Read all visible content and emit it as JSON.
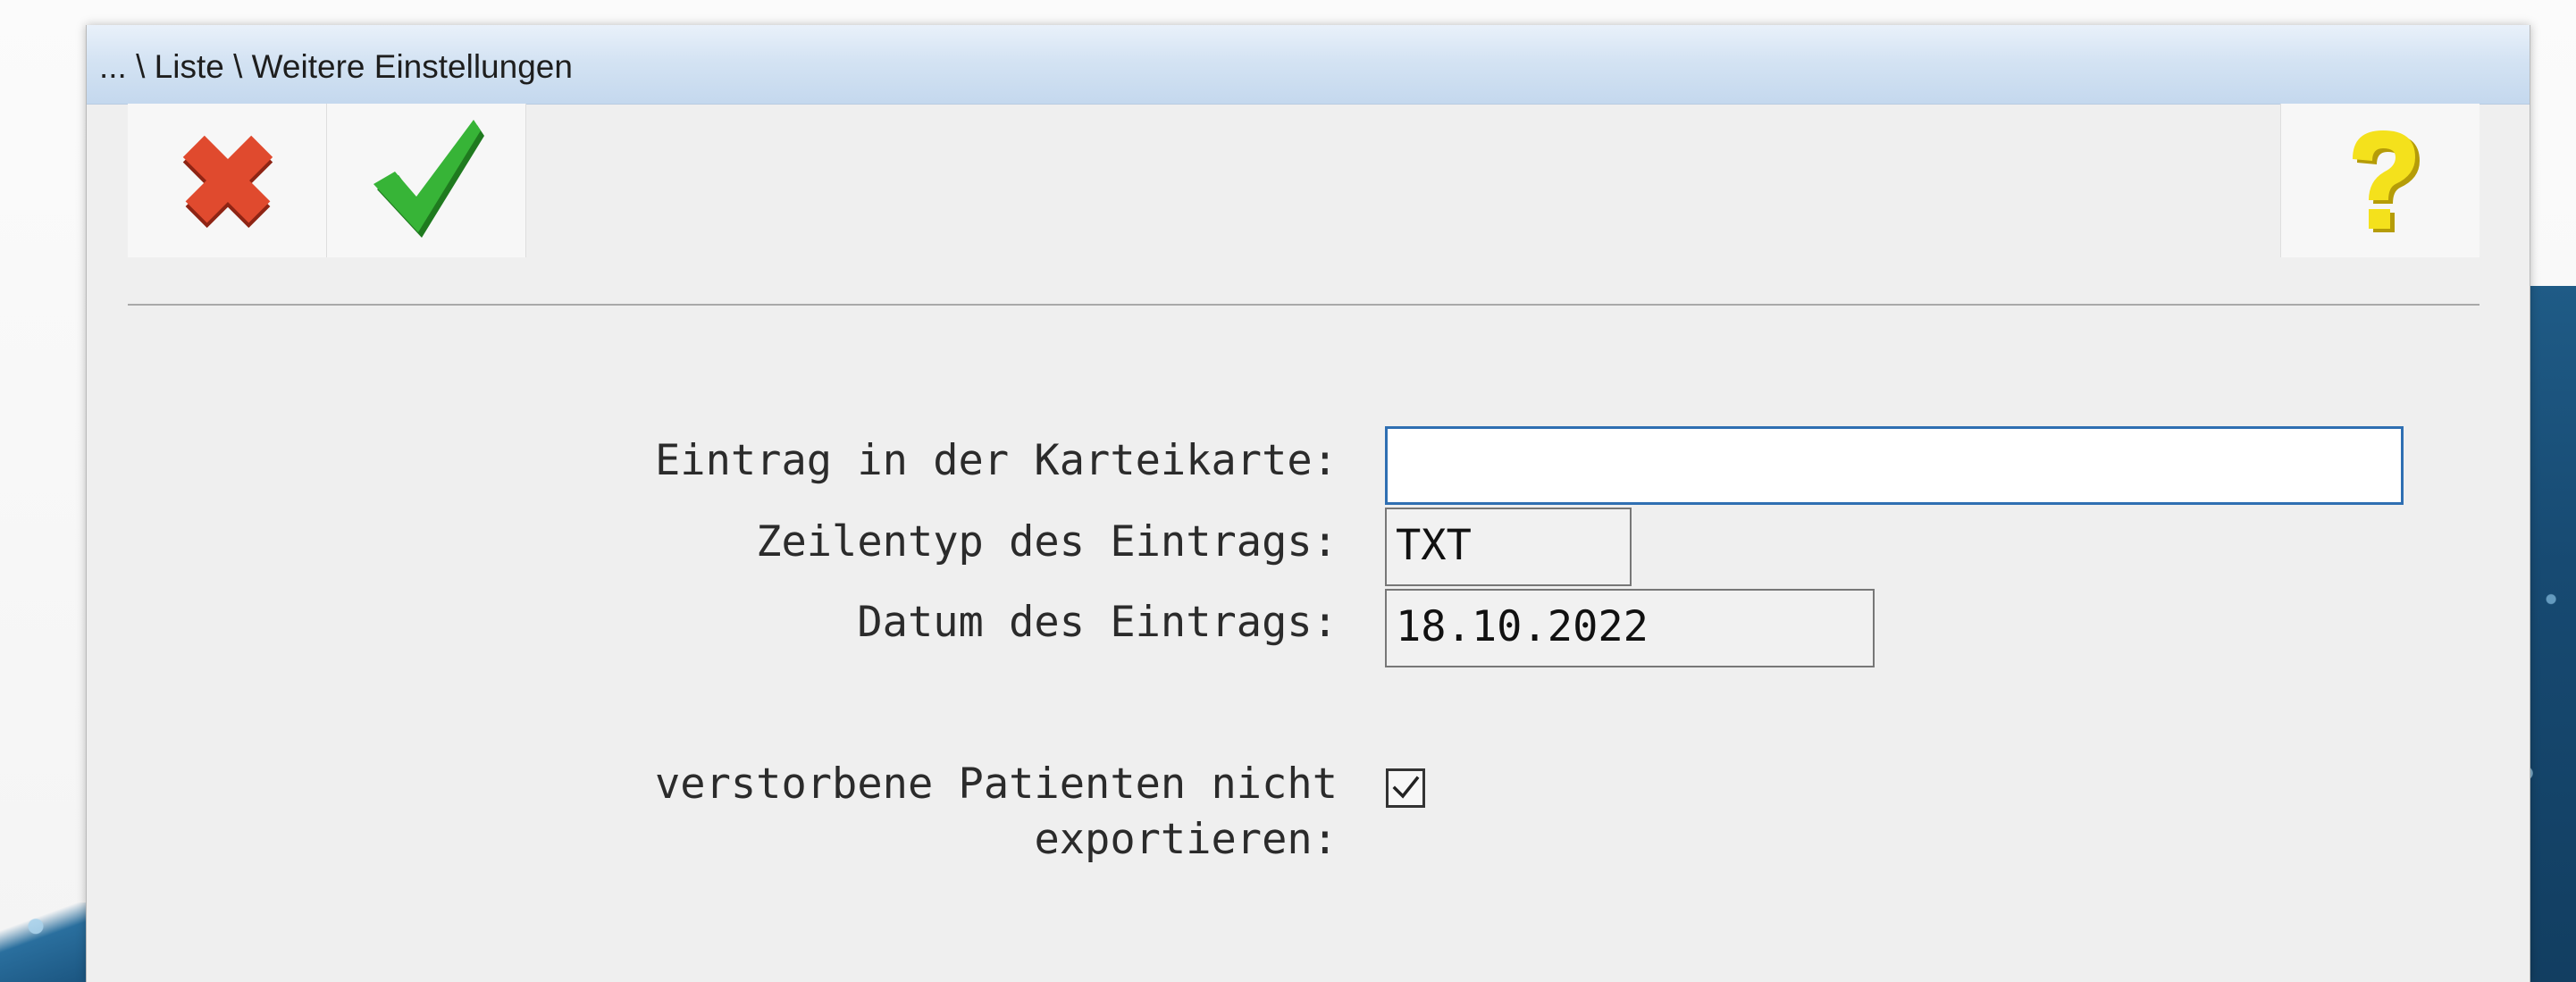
{
  "window": {
    "title": "... \\ Liste \\ Weitere Einstellungen"
  },
  "toolbar": {
    "cancel_icon": "red-x-icon",
    "ok_icon": "green-checkmark-icon",
    "help_icon": "yellow-question-mark-icon",
    "colors": {
      "cancel": "#d9452b",
      "ok": "#2e9b2e",
      "help": "#f2dd1a"
    }
  },
  "form": {
    "entry_label": "Eintrag in der Karteikarte:",
    "entry_value": "",
    "linetype_label": "Zeilentyp des Eintrags:",
    "linetype_value": "TXT",
    "date_label": "Datum des Eintrags:",
    "date_value": "18.10.2022",
    "deceased_label_line1": "verstorbene Patienten nicht",
    "deceased_label_line2": "exportieren:",
    "deceased_checked": true
  }
}
